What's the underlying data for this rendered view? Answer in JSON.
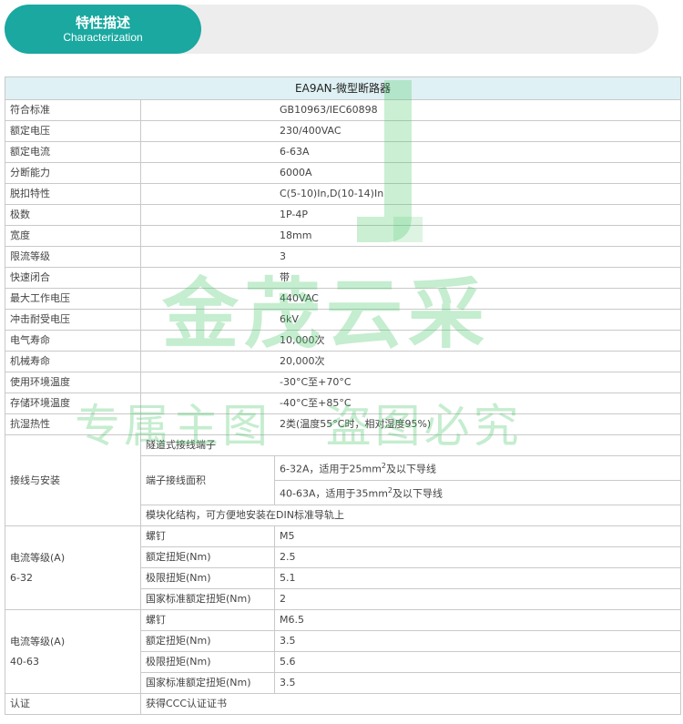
{
  "header": {
    "title_cn": "特性描述",
    "title_en": "Characterization"
  },
  "table": {
    "title": "EA9AN-微型断路器",
    "rows": [
      {
        "label": "符合标准",
        "value": "GB10963/IEC60898"
      },
      {
        "label": "额定电压",
        "value": "230/400VAC"
      },
      {
        "label": "额定电流",
        "value": "6-63A"
      },
      {
        "label": "分断能力",
        "value": "6000A"
      },
      {
        "label": "脱扣特性",
        "value": "C(5-10)In,D(10-14)In"
      },
      {
        "label": "极数",
        "value": "1P-4P"
      },
      {
        "label": "宽度",
        "value": "18mm"
      },
      {
        "label": "限流等级",
        "value": "3"
      },
      {
        "label": "快速闭合",
        "value": "带"
      },
      {
        "label": "最大工作电压",
        "value": "440VAC"
      },
      {
        "label": "冲击耐受电压",
        "value": "6kV"
      },
      {
        "label": "电气寿命",
        "value": "10,000次"
      },
      {
        "label": "机械寿命",
        "value": "20,000次"
      },
      {
        "label": "使用环境温度",
        "value": "-30°C至+70°C"
      },
      {
        "label": "存储环境温度",
        "value": "-40°C至+85°C"
      },
      {
        "label": "抗湿热性",
        "value": "2类(温度55°C时，相对湿度95%)"
      }
    ],
    "wiring": {
      "label": "接线与安装",
      "tunnel": "隧道式接线端子",
      "area_label": "端子接线面积",
      "area_1_pre": "6-32A，适用于25mm",
      "area_1_sup": "2",
      "area_1_post": "及以下导线",
      "area_2_pre": "40-63A，适用于35mm",
      "area_2_sup": "2",
      "area_2_post": "及以下导线",
      "din": "模块化结构，可方便地安装在DIN标准导轨上"
    },
    "group_1": {
      "label_1": "电流等级(A)",
      "label_2": "6-32",
      "rows": [
        {
          "label": "螺钉",
          "value": "M5"
        },
        {
          "label": "额定扭矩(Nm)",
          "value": "2.5"
        },
        {
          "label": "极限扭矩(Nm)",
          "value": "5.1"
        },
        {
          "label": "国家标准额定扭矩(Nm)",
          "value": "2"
        }
      ]
    },
    "group_2": {
      "label_1": "电流等级(A)",
      "label_2": "40-63",
      "rows": [
        {
          "label": "螺钉",
          "value": "M6.5"
        },
        {
          "label": "额定扭矩(Nm)",
          "value": "3.5"
        },
        {
          "label": "极限扭矩(Nm)",
          "value": "5.6"
        },
        {
          "label": "国家标准额定扭矩(Nm)",
          "value": "3.5"
        }
      ]
    },
    "cert": {
      "label": "认证",
      "value": "获得CCC认证证书"
    }
  },
  "watermark": {
    "big": "金茂云采",
    "small": "专属主图   盗图必究"
  },
  "colors": {
    "accent": "#1aa8a0",
    "title_bg": "#dff1f4",
    "watermark": "#40c460"
  }
}
